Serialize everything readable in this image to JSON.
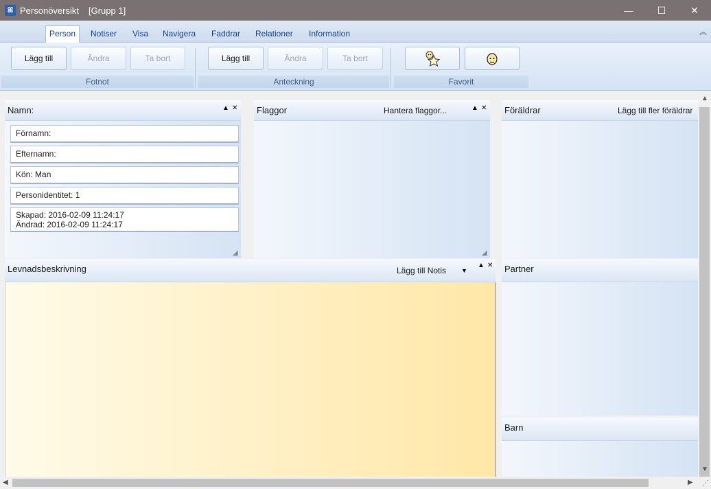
{
  "window": {
    "title": "Personöversikt",
    "group": "[Grupp 1]",
    "app_icon": "app-logo-icon",
    "controls": {
      "minimize": "—",
      "maximize": "☐",
      "close": "✕"
    }
  },
  "ribbon": {
    "tabs": [
      {
        "label": "Person",
        "active": true
      },
      {
        "label": "Notiser"
      },
      {
        "label": "Visa"
      },
      {
        "label": "Navigera"
      },
      {
        "label": "Faddrar"
      },
      {
        "label": "Relationer"
      },
      {
        "label": "Information"
      }
    ],
    "groups": {
      "fotnot": {
        "label": "Fotnot",
        "add": "Lägg till",
        "edit": "Ändra",
        "delete": "Ta bort"
      },
      "anteckning": {
        "label": "Anteckning",
        "add": "Lägg till",
        "edit": "Ändra",
        "delete": "Ta bort"
      },
      "favorit": {
        "label": "Favorit",
        "icons": [
          "star-person-icon",
          "face-icon"
        ]
      }
    }
  },
  "panels": {
    "namn": {
      "title": "Namn:",
      "fields": {
        "fornamn": "Förnamn:",
        "efternamn": "Efternamn:",
        "kon": "Kön: Man",
        "personidentitet": "Personidentitet: 1",
        "skapad": "Skapad: 2016-02-09 11:24:17",
        "andrad": "Ändrad: 2016-02-09 11:24:17"
      }
    },
    "flaggor": {
      "title": "Flaggor",
      "link": "Hantera flaggor..."
    },
    "foraldrar": {
      "title": "Föräldrar",
      "link": "Lägg till fler föräldrar"
    },
    "levnadsbeskrivning": {
      "title": "Levnadsbeskrivning",
      "link": "Lägg till Notis"
    },
    "partner": {
      "title": "Partner"
    },
    "barn": {
      "title": "Barn"
    }
  },
  "panel_controls": {
    "pin": "▲",
    "close": "✕",
    "dropdown": "▼"
  },
  "colors": {
    "titlebar": "#7a7272",
    "ribbon_text": "#15428b",
    "notes_gradient_start": "#fffbe9",
    "notes_gradient_end": "#ffe7a7"
  }
}
